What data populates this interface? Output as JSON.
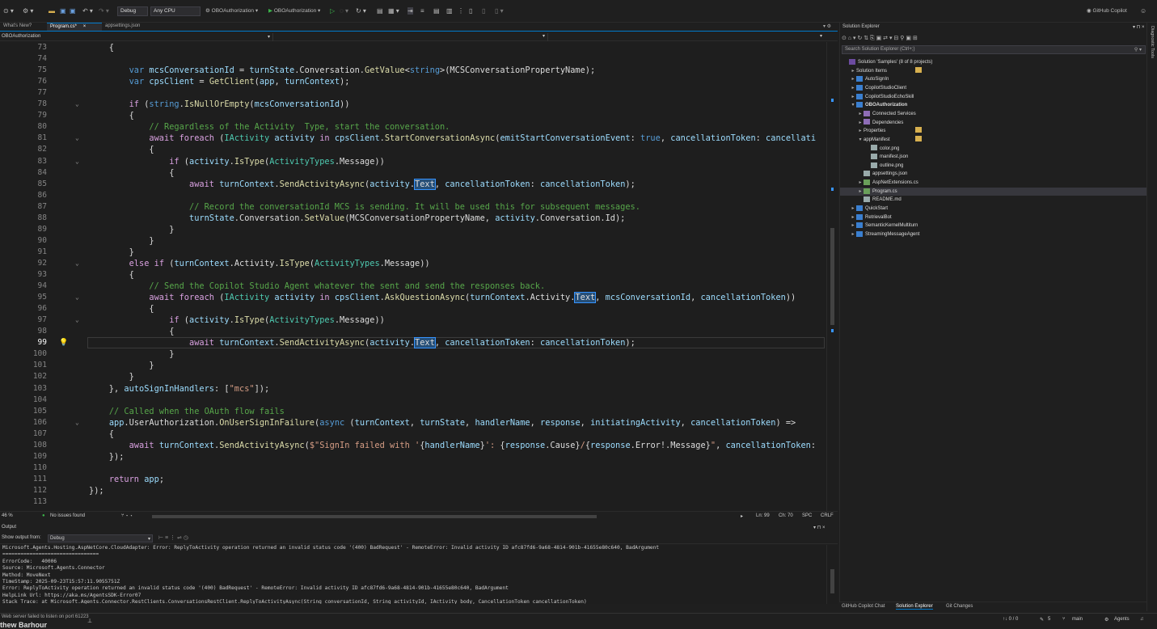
{
  "toolbar": {
    "config": "Debug",
    "platform": "Any CPU",
    "startup_project": "OBOAuthorization",
    "run_target": "OBOAuthorization",
    "copilot": "GitHub Copilot"
  },
  "tabs": [
    {
      "label": "What's New?"
    },
    {
      "label": "Program.cs*"
    },
    {
      "label": "appsettings.json"
    }
  ],
  "navbar": {
    "project": "OBOAuthorization"
  },
  "editor": {
    "lines": [
      {
        "n": "73",
        "html": "    {"
      },
      {
        "n": "74",
        "html": ""
      },
      {
        "n": "75",
        "html": "        <span class=\"kw\">var</span> <span class=\"prm\">mcsConversationId</span> = <span class=\"prm\">turnState</span>.Conversation.<span class=\"fn\">GetValue</span>&lt;<span class=\"kw\">string</span>&gt;(MCSConversationPropertyName);"
      },
      {
        "n": "76",
        "html": "        <span class=\"kw\">var</span> <span class=\"prm\">cpsClient</span> = <span class=\"fn\">GetClient</span>(<span class=\"prm\">app</span>, <span class=\"prm\">turnContext</span>);"
      },
      {
        "n": "77",
        "html": ""
      },
      {
        "n": "78",
        "html": "        <span class=\"ctl\">if</span> (<span class=\"kw\">string</span>.<span class=\"fn\">IsNullOrEmpty</span>(<span class=\"prm\">mcsConversationId</span>))"
      },
      {
        "n": "79",
        "html": "        {"
      },
      {
        "n": "80",
        "html": "            <span class=\"cm\">// Regardless of the Activity  Type, start the conversation.</span>"
      },
      {
        "n": "81",
        "html": "            <span class=\"ctl\">await</span> <span class=\"ctl\">foreach</span> (<span class=\"ty\">IActivity</span> <span class=\"prm\">activity</span> <span class=\"ctl\">in</span> <span class=\"prm\">cpsClient</span>.<span class=\"fn\">StartConversationAsync</span>(<span class=\"prm\">emitStartConversationEvent</span>: <span class=\"kw\">true</span>, <span class=\"prm\">cancellationToken</span>: <span class=\"prm\">cancellati</span>"
      },
      {
        "n": "82",
        "html": "            {"
      },
      {
        "n": "83",
        "html": "                <span class=\"ctl\">if</span> (<span class=\"prm\">activity</span>.<span class=\"fn\">IsType</span>(<span class=\"ty\">ActivityTypes</span>.Message))"
      },
      {
        "n": "84",
        "html": "                {"
      },
      {
        "n": "85",
        "html": "                    <span class=\"ctl\">await</span> <span class=\"prm\">turnContext</span>.<span class=\"fn\">SendActivityAsync</span>(<span class=\"prm\">activity</span>.<span class=\"hl\">Text</span>, <span class=\"prm\">cancellationToken</span>: <span class=\"prm\">cancellationToken</span>);"
      },
      {
        "n": "86",
        "html": ""
      },
      {
        "n": "87",
        "html": "                    <span class=\"cm\">// Record the conversationId MCS is sending. It will be used this for subsequent messages.</span>"
      },
      {
        "n": "88",
        "html": "                    <span class=\"prm\">turnState</span>.Conversation.<span class=\"fn\">SetValue</span>(MCSConversationPropertyName, <span class=\"prm\">activity</span>.Conversation.Id);"
      },
      {
        "n": "89",
        "html": "                }"
      },
      {
        "n": "90",
        "html": "            }"
      },
      {
        "n": "91",
        "html": "        }"
      },
      {
        "n": "92",
        "html": "        <span class=\"ctl\">else</span> <span class=\"ctl\">if</span> (<span class=\"prm\">turnContext</span>.Activity.<span class=\"fn\">IsType</span>(<span class=\"ty\">ActivityTypes</span>.Message))"
      },
      {
        "n": "93",
        "html": "        {"
      },
      {
        "n": "94",
        "html": "            <span class=\"cm\">// Send the Copilot Studio Agent whatever the sent and send the responses back.</span>"
      },
      {
        "n": "95",
        "html": "            <span class=\"ctl\">await</span> <span class=\"ctl\">foreach</span> (<span class=\"ty\">IActivity</span> <span class=\"prm\">activity</span> <span class=\"ctl\">in</span> <span class=\"prm\">cpsClient</span>.<span class=\"fn\">AskQuestionAsync</span>(<span class=\"prm\">turnContext</span>.Activity.<span class=\"hl\">Text</span>, <span class=\"prm\">mcsConversationId</span>, <span class=\"prm\">cancellationToken</span>))"
      },
      {
        "n": "96",
        "html": "            {"
      },
      {
        "n": "97",
        "html": "                <span class=\"ctl\">if</span> (<span class=\"prm\">activity</span>.<span class=\"fn\">IsType</span>(<span class=\"ty\">ActivityTypes</span>.Message))"
      },
      {
        "n": "98",
        "html": "                {"
      },
      {
        "n": "99",
        "html": "                    <span class=\"ctl\">await</span> <span class=\"prm\">turnContext</span>.<span class=\"fn\">SendActivityAsync</span>(<span class=\"prm\">activity</span>.<span class=\"hl\">Text</span>, <span class=\"prm\">cancellationToken</span>: <span class=\"prm\">cancellationToken</span>);"
      },
      {
        "n": "100",
        "html": "                }"
      },
      {
        "n": "101",
        "html": "            }"
      },
      {
        "n": "102",
        "html": "        }"
      },
      {
        "n": "103",
        "html": "    }, <span class=\"prm\">autoSignInHandlers</span>: [<span class=\"str\">\"mcs\"</span>]);"
      },
      {
        "n": "104",
        "html": ""
      },
      {
        "n": "105",
        "html": "    <span class=\"cm\">// Called when the OAuth flow fails</span>"
      },
      {
        "n": "106",
        "html": "    <span class=\"prm\">app</span>.UserAuthorization.<span class=\"fn\">OnUserSignInFailure</span>(<span class=\"kw\">async</span> (<span class=\"prm\">turnContext</span>, <span class=\"prm\">turnState</span>, <span class=\"prm\">handlerName</span>, <span class=\"prm\">response</span>, <span class=\"prm\">initiatingActivity</span>, <span class=\"prm\">cancellationToken</span>) =&gt;"
      },
      {
        "n": "107",
        "html": "    {"
      },
      {
        "n": "108",
        "html": "        <span class=\"ctl\">await</span> <span class=\"prm\">turnContext</span>.<span class=\"fn\">SendActivityAsync</span>(<span class=\"str\">$\"SignIn failed with '</span>{<span class=\"prm\">handlerName</span>}<span class=\"str\">': </span>{<span class=\"prm\">response</span>.Cause}<span class=\"str\">/</span>{<span class=\"prm\">response</span>.Error!.Message}<span class=\"str\">\"</span>, <span class=\"prm\">cancellationToken</span>:"
      },
      {
        "n": "109",
        "html": "    });"
      },
      {
        "n": "110",
        "html": ""
      },
      {
        "n": "111",
        "html": "    <span class=\"ctl\">return</span> <span class=\"prm\">app</span>;"
      },
      {
        "n": "112",
        "html": "});"
      },
      {
        "n": "113",
        "html": ""
      }
    ]
  },
  "status_editor": {
    "zoom": "46 %",
    "issues": "No issues found",
    "ln": "Ln: 99",
    "ch": "Ch: 70",
    "spc": "SPC",
    "crlf": "CRLF"
  },
  "output": {
    "title": "Output",
    "show_from_label": "Show output from:",
    "source": "Debug",
    "lines": [
      "Microsoft.Agents.Hosting.AspNetCore.CloudAdapter: Error: ReplyToActivity operation returned an invalid status code '(400) BadRequest' - RemoteError: Invalid activity ID afc87fd6-9a68-4814-901b-41655e80c640, BadArgument",
      "================================",
      "ErrorCode:   40006",
      "Source: Microsoft.Agents.Connector",
      "Method: MoveNext",
      "TimeStamp: 2025-09-23T15:57:11.9055751Z",
      "Error: ReplyToActivity operation returned an invalid status code '(400) BadRequest' - RemoteError: Invalid activity ID afc87fd6-9a68-4814-901b-41655e80c640, BadArgument",
      "HelpLink Url: https://aka.ms/AgentsSDK-Error07",
      "Stack Trace: at Microsoft.Agents.Connector.RestClients.ConversationsRestClient.ReplyToActivityAsync(String conversationId, String activityId, IActivity body, CancellationToken cancellationToken)"
    ]
  },
  "solution_explorer": {
    "title": "Solution Explorer",
    "search_placeholder": "Search Solution Explorer (Ctrl+;)",
    "items": [
      {
        "label": "Solution 'Samples' (8 of 8 projects)",
        "icon": "sol",
        "depth": 0,
        "arrow": ""
      },
      {
        "label": "Solution Items",
        "icon": "fold",
        "depth": 1,
        "arrow": "▸"
      },
      {
        "label": "AutoSignIn",
        "icon": "proj",
        "depth": 1,
        "arrow": "▸"
      },
      {
        "label": "CopilotStudioClient",
        "icon": "proj",
        "depth": 1,
        "arrow": "▸"
      },
      {
        "label": "CopilotStudioEchoSkill",
        "icon": "proj",
        "depth": 1,
        "arrow": "▸"
      },
      {
        "label": "OBOAuthorization",
        "icon": "proj",
        "depth": 1,
        "arrow": "▾",
        "bold": true
      },
      {
        "label": "Connected Services",
        "icon": "dep",
        "depth": 2,
        "arrow": "▸"
      },
      {
        "label": "Dependencies",
        "icon": "dep",
        "depth": 2,
        "arrow": "▸"
      },
      {
        "label": "Properties",
        "icon": "fold",
        "depth": 2,
        "arrow": "▸"
      },
      {
        "label": "appManifest",
        "icon": "fold",
        "depth": 2,
        "arrow": "▾"
      },
      {
        "label": "color.png",
        "icon": "file",
        "depth": 3,
        "arrow": ""
      },
      {
        "label": "manifest.json",
        "icon": "file",
        "depth": 3,
        "arrow": ""
      },
      {
        "label": "outline.png",
        "icon": "file",
        "depth": 3,
        "arrow": ""
      },
      {
        "label": "appsettings.json",
        "icon": "file",
        "depth": 2,
        "arrow": ""
      },
      {
        "label": "AspNetExtensions.cs",
        "icon": "cs",
        "depth": 2,
        "arrow": "▸"
      },
      {
        "label": "Program.cs",
        "icon": "cs",
        "depth": 2,
        "arrow": "▸",
        "selected": true
      },
      {
        "label": "README.md",
        "icon": "file",
        "depth": 2,
        "arrow": ""
      },
      {
        "label": "QuickStart",
        "icon": "proj",
        "depth": 1,
        "arrow": "▸"
      },
      {
        "label": "RetrievalBot",
        "icon": "proj",
        "depth": 1,
        "arrow": "▸"
      },
      {
        "label": "SemanticKernelMultiturn",
        "icon": "proj",
        "depth": 1,
        "arrow": "▸"
      },
      {
        "label": "StreamingMessageAgent",
        "icon": "proj",
        "depth": 1,
        "arrow": "▸"
      }
    ],
    "tabs": [
      "GitHub Copilot Chat",
      "Solution Explorer",
      "Git Changes"
    ]
  },
  "right_strip": {
    "label": "Diagnostic Tools"
  },
  "main_status": {
    "message": "Web server failed to listen on port 61223",
    "branch": "main",
    "agents": "Agents",
    "counts": "↑↓ 0 / 0",
    "edits": "5",
    "overlay": "thew Barhour"
  }
}
